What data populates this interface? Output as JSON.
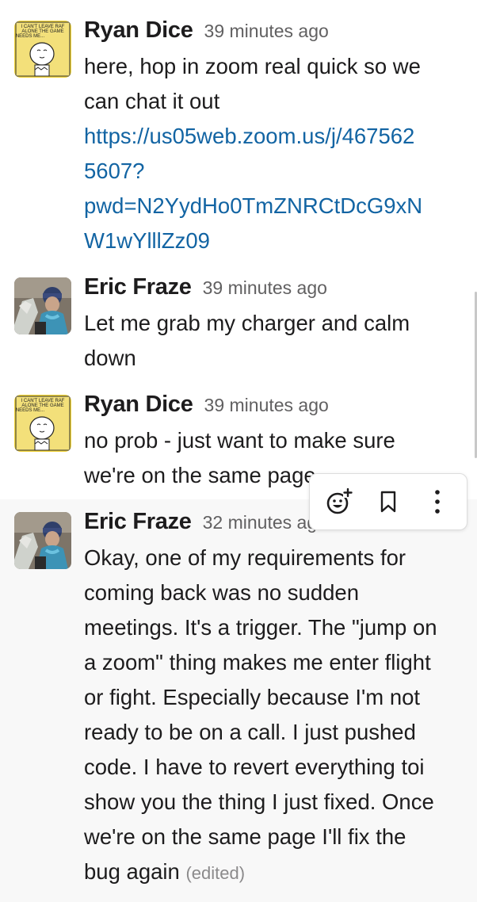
{
  "messages": [
    {
      "author": "Ryan Dice",
      "timestamp": "39 minutes ago",
      "avatar": "charlie-brown-comic-avatar",
      "avatar_caption": "I CAN'T LEAVE RAF ALONE THE GAME NEEDS ME...",
      "lines": [
        "here, hop in zoom real quick so we",
        "can chat it out"
      ],
      "link_lines": [
        "https://us05web.zoom.us/j/467562",
        "5607?",
        "pwd=N2YydHo0TmZNRCtDcG9xN",
        "W1wYlllZz09"
      ]
    },
    {
      "author": "Eric Fraze",
      "timestamp": "39 minutes ago",
      "avatar": "photo-avatar",
      "lines": [
        "Let me grab my charger and calm",
        "down"
      ]
    },
    {
      "author": "Ryan Dice",
      "timestamp": "39 minutes ago",
      "avatar": "charlie-brown-comic-avatar",
      "avatar_caption": "I CAN'T LEAVE RAF ALONE THE GAME NEEDS ME...",
      "lines": [
        "no prob - just want to make sure",
        "we're on the same page"
      ]
    },
    {
      "author": "Eric Fraze",
      "timestamp": "32 minutes ago",
      "avatar": "photo-avatar",
      "lines": [
        "Okay, one of my requirements for",
        "coming back was no sudden",
        "meetings. It's a trigger. The \"jump on",
        "a zoom\" thing makes me enter flight",
        "or fight. Especially because I'm not",
        "ready to be on a call. I just pushed",
        "code. I have to revert everything toi",
        "show you the thing I just fixed. Once",
        "we're on the same page I'll fix the",
        "bug again"
      ],
      "edited_label": "(edited)"
    }
  ],
  "hover_toolbar": {
    "icons": [
      "add-reaction-icon",
      "bookmark-icon",
      "more-actions-icon"
    ]
  },
  "colors": {
    "link": "#1264a3",
    "text": "#1d1c1d",
    "muted": "#616061",
    "hover_background": "#f8f8f8"
  }
}
